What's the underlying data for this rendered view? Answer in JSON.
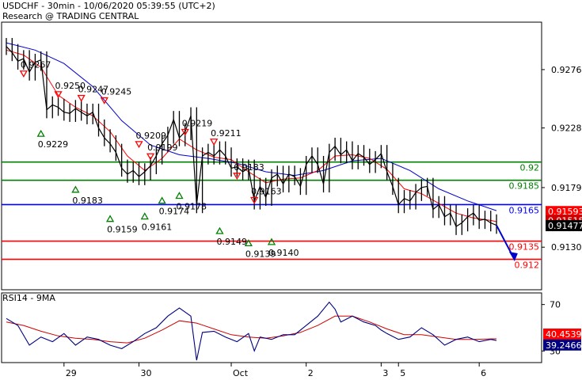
{
  "header": {
    "line1": "USDCHF - 30min - 10/06/2020 05:39:55 (UTC+2)",
    "line2": "Research @ TRADING CENTRAL"
  },
  "chart_data": {
    "type": "line",
    "price": {
      "ylim": [
        0.9095,
        0.9315
      ],
      "y_ticks": [
        "0.9276",
        "0.9228",
        "0.9179",
        "0.9130"
      ],
      "y_tick_values": [
        0.9276,
        0.9228,
        0.9179,
        0.913
      ],
      "x_ticks": [
        "29",
        "30",
        "Oct",
        "2",
        "3",
        "5",
        "6"
      ],
      "x_tick_values": [
        10,
        23,
        39,
        52,
        65,
        68,
        82
      ],
      "x_range": [
        0,
        92
      ],
      "close_series": [
        [
          0,
          0.9295
        ],
        [
          1,
          0.929
        ],
        [
          2,
          0.9283
        ],
        [
          3,
          0.9285
        ],
        [
          4,
          0.9274
        ],
        [
          5,
          0.9282
        ],
        [
          6,
          0.9284
        ],
        [
          7,
          0.9243
        ],
        [
          8,
          0.9247
        ],
        [
          9,
          0.9245
        ],
        [
          10,
          0.9241
        ],
        [
          11,
          0.924
        ],
        [
          12,
          0.9244
        ],
        [
          13,
          0.9241
        ],
        [
          14,
          0.9238
        ],
        [
          15,
          0.9241
        ],
        [
          16,
          0.9228
        ],
        [
          17,
          0.922
        ],
        [
          18,
          0.9215
        ],
        [
          19,
          0.9208
        ],
        [
          20,
          0.9195
        ],
        [
          21,
          0.919
        ],
        [
          22,
          0.9193
        ],
        [
          23,
          0.9188
        ],
        [
          24,
          0.9192
        ],
        [
          25,
          0.9197
        ],
        [
          26,
          0.9205
        ],
        [
          27,
          0.9215
        ],
        [
          28,
          0.9222
        ],
        [
          29,
          0.9235
        ],
        [
          30,
          0.922
        ],
        [
          31,
          0.9225
        ],
        [
          32,
          0.9238
        ],
        [
          33,
          0.9165
        ],
        [
          34,
          0.9205
        ],
        [
          35,
          0.9208
        ],
        [
          36,
          0.9205
        ],
        [
          37,
          0.921
        ],
        [
          38,
          0.9205
        ],
        [
          39,
          0.9195
        ],
        [
          40,
          0.9196
        ],
        [
          41,
          0.9192
        ],
        [
          42,
          0.9195
        ],
        [
          43,
          0.9168
        ],
        [
          44,
          0.918
        ],
        [
          45,
          0.9171
        ],
        [
          46,
          0.9187
        ],
        [
          47,
          0.919
        ],
        [
          48,
          0.9182
        ],
        [
          49,
          0.919
        ],
        [
          50,
          0.9188
        ],
        [
          51,
          0.918
        ],
        [
          52,
          0.9198
        ],
        [
          53,
          0.9205
        ],
        [
          54,
          0.9198
        ],
        [
          55,
          0.9182
        ],
        [
          56,
          0.9208
        ],
        [
          57,
          0.9213
        ],
        [
          58,
          0.9206
        ],
        [
          59,
          0.921
        ],
        [
          60,
          0.9201
        ],
        [
          61,
          0.9207
        ],
        [
          62,
          0.9204
        ],
        [
          63,
          0.9198
        ],
        [
          64,
          0.9202
        ],
        [
          65,
          0.9207
        ],
        [
          66,
          0.9192
        ],
        [
          67,
          0.918
        ],
        [
          68,
          0.9165
        ],
        [
          69,
          0.917
        ],
        [
          70,
          0.9168
        ],
        [
          71,
          0.9175
        ],
        [
          72,
          0.9179
        ],
        [
          73,
          0.918
        ],
        [
          74,
          0.9161
        ],
        [
          75,
          0.9165
        ],
        [
          76,
          0.9155
        ],
        [
          77,
          0.9158
        ],
        [
          78,
          0.9147
        ],
        [
          79,
          0.915
        ],
        [
          80,
          0.9155
        ],
        [
          81,
          0.9158
        ],
        [
          82,
          0.9152
        ],
        [
          83,
          0.9153
        ],
        [
          84,
          0.915
        ],
        [
          85,
          0.9148
        ]
      ],
      "sma_red": [
        [
          0,
          0.9292
        ],
        [
          3,
          0.9288
        ],
        [
          6,
          0.9278
        ],
        [
          9,
          0.9255
        ],
        [
          12,
          0.9245
        ],
        [
          15,
          0.9238
        ],
        [
          18,
          0.9225
        ],
        [
          21,
          0.9205
        ],
        [
          24,
          0.9193
        ],
        [
          27,
          0.9203
        ],
        [
          30,
          0.9219
        ],
        [
          33,
          0.921
        ],
        [
          36,
          0.9204
        ],
        [
          39,
          0.9202
        ],
        [
          42,
          0.9192
        ],
        [
          45,
          0.9183
        ],
        [
          48,
          0.9186
        ],
        [
          51,
          0.9187
        ],
        [
          54,
          0.9193
        ],
        [
          57,
          0.9205
        ],
        [
          60,
          0.9206
        ],
        [
          63,
          0.9203
        ],
        [
          66,
          0.9194
        ],
        [
          69,
          0.9178
        ],
        [
          72,
          0.9174
        ],
        [
          75,
          0.9166
        ],
        [
          78,
          0.9158
        ],
        [
          81,
          0.9154
        ],
        [
          84,
          0.9152
        ],
        [
          85,
          0.9151
        ]
      ],
      "sma_blue": [
        [
          0,
          0.9298
        ],
        [
          5,
          0.9292
        ],
        [
          10,
          0.9281
        ],
        [
          15,
          0.9262
        ],
        [
          20,
          0.9234
        ],
        [
          25,
          0.9214
        ],
        [
          30,
          0.9206
        ],
        [
          35,
          0.9203
        ],
        [
          40,
          0.9199
        ],
        [
          45,
          0.9192
        ],
        [
          50,
          0.9189
        ],
        [
          55,
          0.9193
        ],
        [
          60,
          0.9201
        ],
        [
          65,
          0.9203
        ],
        [
          70,
          0.9193
        ],
        [
          75,
          0.9178
        ],
        [
          80,
          0.9168
        ],
        [
          85,
          0.916
        ]
      ],
      "forecast_arrow": [
        [
          85,
          0.9148
        ],
        [
          88,
          0.9121
        ]
      ],
      "levels": [
        {
          "value": 0.92,
          "label": "0.92",
          "color": "#008000"
        },
        {
          "value": 0.9185,
          "label": "0.9185",
          "color": "#008000"
        },
        {
          "value": 0.9165,
          "label": "0.9165",
          "color": "#0000ff"
        },
        {
          "value": 0.9135,
          "label": "0.9135",
          "color": "#ff0000"
        },
        {
          "value": 0.912,
          "label": "0.912",
          "color": "#ff0000"
        }
      ],
      "price_tags": [
        {
          "value": 0.91593,
          "label": "0.91593",
          "color": "#ff0000"
        },
        {
          "value": 0.91518,
          "label": "0.91518",
          "color": "#cc0000"
        },
        {
          "value": 0.91477,
          "label": "0.91477",
          "color": "#000000"
        }
      ],
      "pivots": [
        {
          "x": 3,
          "value": 0.9267,
          "label": "0.9267",
          "kind": "high"
        },
        {
          "x": 9,
          "value": 0.925,
          "label": "0.9250",
          "kind": "high"
        },
        {
          "x": 13,
          "value": 0.9247,
          "label": "0.9247",
          "kind": "high"
        },
        {
          "x": 6,
          "value": 0.9229,
          "label": "0.9229",
          "kind": "low"
        },
        {
          "x": 17,
          "value": 0.9245,
          "label": "0.9245",
          "kind": "high"
        },
        {
          "x": 12,
          "value": 0.9183,
          "label": "0.9183",
          "kind": "low"
        },
        {
          "x": 18,
          "value": 0.9159,
          "label": "0.9159",
          "kind": "low"
        },
        {
          "x": 23,
          "value": 0.9209,
          "label": "0.9209",
          "kind": "high"
        },
        {
          "x": 25,
          "value": 0.9199,
          "label": "0.9199",
          "kind": "high"
        },
        {
          "x": 24,
          "value": 0.9161,
          "label": "0.9161",
          "kind": "low"
        },
        {
          "x": 27,
          "value": 0.9174,
          "label": "0.9174",
          "kind": "low"
        },
        {
          "x": 30,
          "value": 0.9178,
          "label": "0.9178",
          "kind": "low"
        },
        {
          "x": 31,
          "value": 0.9219,
          "label": "0.9219",
          "kind": "high"
        },
        {
          "x": 36,
          "value": 0.9211,
          "label": "0.9211",
          "kind": "high"
        },
        {
          "x": 37,
          "value": 0.9149,
          "label": "0.9149",
          "kind": "low"
        },
        {
          "x": 40,
          "value": 0.9183,
          "label": "0.9183",
          "kind": "high"
        },
        {
          "x": 43,
          "value": 0.9163,
          "label": "0.9163",
          "kind": "high"
        },
        {
          "x": 42,
          "value": 0.9139,
          "label": "0.9139",
          "kind": "low"
        },
        {
          "x": 46,
          "value": 0.914,
          "label": "0.9140",
          "kind": "low"
        }
      ]
    },
    "rsi": {
      "title": "RSI14 - 9MA",
      "ylim": [
        20,
        80
      ],
      "y_ticks": [
        "70",
        "30"
      ],
      "y_tick_values": [
        70,
        30
      ],
      "rsi_series": [
        [
          0,
          58
        ],
        [
          2,
          52
        ],
        [
          4,
          35
        ],
        [
          6,
          42
        ],
        [
          8,
          38
        ],
        [
          10,
          45
        ],
        [
          12,
          35
        ],
        [
          14,
          42
        ],
        [
          16,
          40
        ],
        [
          18,
          35
        ],
        [
          20,
          32
        ],
        [
          22,
          38
        ],
        [
          24,
          45
        ],
        [
          26,
          50
        ],
        [
          28,
          60
        ],
        [
          30,
          67
        ],
        [
          32,
          60
        ],
        [
          33,
          22
        ],
        [
          34,
          46
        ],
        [
          36,
          47
        ],
        [
          38,
          42
        ],
        [
          40,
          38
        ],
        [
          42,
          45
        ],
        [
          43,
          30
        ],
        [
          44,
          42
        ],
        [
          46,
          40
        ],
        [
          48,
          44
        ],
        [
          50,
          44
        ],
        [
          52,
          52
        ],
        [
          54,
          60
        ],
        [
          56,
          72
        ],
        [
          57,
          66
        ],
        [
          58,
          55
        ],
        [
          60,
          60
        ],
        [
          62,
          55
        ],
        [
          64,
          52
        ],
        [
          65,
          48
        ],
        [
          66,
          45
        ],
        [
          68,
          40
        ],
        [
          70,
          42
        ],
        [
          72,
          50
        ],
        [
          74,
          44
        ],
        [
          76,
          35
        ],
        [
          78,
          40
        ],
        [
          80,
          42
        ],
        [
          82,
          38
        ],
        [
          84,
          40
        ],
        [
          85,
          39
        ]
      ],
      "ma_series": [
        [
          0,
          55
        ],
        [
          3,
          52
        ],
        [
          6,
          47
        ],
        [
          9,
          43
        ],
        [
          12,
          41
        ],
        [
          15,
          40
        ],
        [
          18,
          38
        ],
        [
          21,
          37
        ],
        [
          24,
          41
        ],
        [
          27,
          48
        ],
        [
          30,
          56
        ],
        [
          33,
          54
        ],
        [
          36,
          49
        ],
        [
          39,
          44
        ],
        [
          42,
          42
        ],
        [
          45,
          41
        ],
        [
          48,
          43
        ],
        [
          51,
          46
        ],
        [
          54,
          52
        ],
        [
          57,
          60
        ],
        [
          60,
          60
        ],
        [
          63,
          55
        ],
        [
          66,
          49
        ],
        [
          69,
          44
        ],
        [
          72,
          44
        ],
        [
          75,
          42
        ],
        [
          78,
          40
        ],
        [
          81,
          40
        ],
        [
          85,
          40.5
        ]
      ],
      "tags": [
        {
          "value": 40.4539,
          "label": "40.4539",
          "color": "#ff0000"
        },
        {
          "value": 39.2466,
          "label": "39.2466",
          "color": "#000080"
        }
      ]
    },
    "colors": {
      "price": "#000000",
      "sma_red": "#ff0000",
      "sma_blue": "#0000cc",
      "pivot_high": "#ff0000",
      "pivot_low": "#008000",
      "arrow": "#0000cc"
    }
  }
}
